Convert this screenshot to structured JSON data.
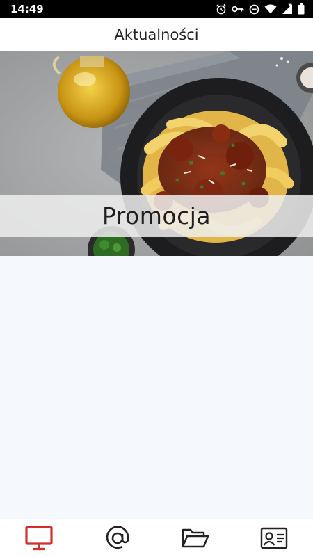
{
  "status_bar": {
    "time": "14:49",
    "icons": [
      "alarm-icon",
      "vpn-key-icon",
      "do-not-disturb-icon",
      "wifi-icon",
      "signal-icon",
      "battery-icon"
    ]
  },
  "app_bar": {
    "title": "Aktualności"
  },
  "news": {
    "banner_label": "Promocja",
    "image": "pasta-dish-photo"
  },
  "bottom_nav": {
    "active_color": "#d32f2f",
    "inactive_color": "#222222",
    "items": [
      {
        "icon": "monitor-icon",
        "active": true
      },
      {
        "icon": "at-sign-icon",
        "active": false
      },
      {
        "icon": "folder-open-icon",
        "active": false
      },
      {
        "icon": "contact-card-icon",
        "active": false
      }
    ]
  }
}
